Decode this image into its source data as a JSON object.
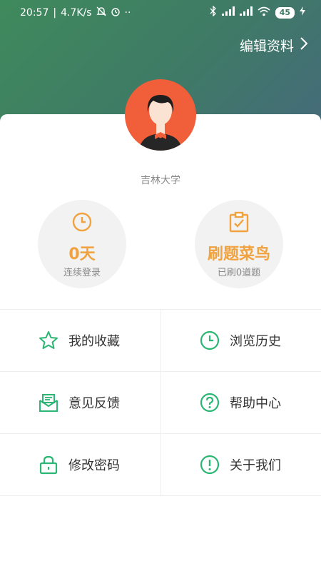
{
  "status_bar": {
    "time": "20:57",
    "speed": "4.7K/s",
    "battery": "45"
  },
  "header": {
    "edit_profile": "编辑资料"
  },
  "profile": {
    "school": "吉林大学"
  },
  "stats": {
    "login": {
      "value": "0天",
      "label": "连续登录"
    },
    "level": {
      "value": "刷题菜鸟",
      "label": "已刷0道题"
    }
  },
  "menu": {
    "favorites": "我的收藏",
    "history": "浏览历史",
    "feedback": "意见反馈",
    "help": "帮助中心",
    "change_password": "修改密码",
    "about": "关于我们"
  },
  "colors": {
    "accent_green": "#2bb673",
    "accent_orange": "#f0a23e",
    "header_green": "#3f8a5c"
  }
}
